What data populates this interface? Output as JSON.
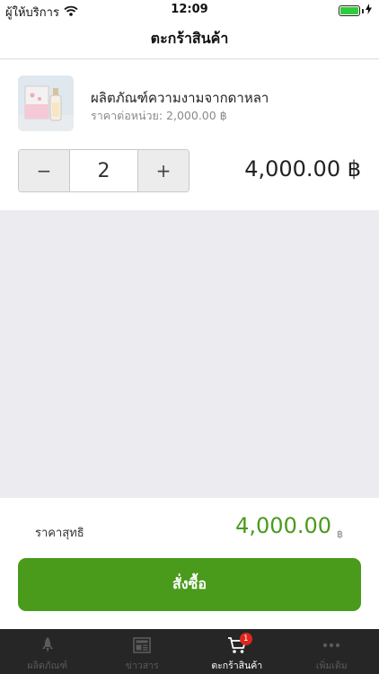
{
  "status_bar": {
    "carrier": "ผู้ให้บริการ",
    "time": "12:09"
  },
  "nav": {
    "title": "ตะกร้าสินค้า"
  },
  "cart_item": {
    "name": "ผลิตภัณฑ์ความงามจากดาหลา",
    "unit_price": "ราคาต่อหน่วย: 2,000.00 ฿",
    "decrement": "−",
    "quantity": "2",
    "increment": "+",
    "line_total": "4,000.00 ฿"
  },
  "summary": {
    "label": "ราคาสุทธิ",
    "value": "4,000.00",
    "currency": "฿",
    "order_button": "สั่งซื้อ"
  },
  "tabs": [
    {
      "label": "ผลิตภัณฑ์",
      "icon": "rocket-icon",
      "active": false
    },
    {
      "label": "ข่าวสาร",
      "icon": "newspaper-icon",
      "active": false
    },
    {
      "label": "ตะกร้าสินค้า",
      "icon": "cart-icon",
      "active": true,
      "badge": "1"
    },
    {
      "label": "เพิ่มเติม",
      "icon": "more-icon",
      "active": false
    }
  ],
  "colors": {
    "accent": "#4a9a1c",
    "tabbar": "#262626",
    "badge": "#e0241b",
    "battery": "#2fcc3a"
  }
}
